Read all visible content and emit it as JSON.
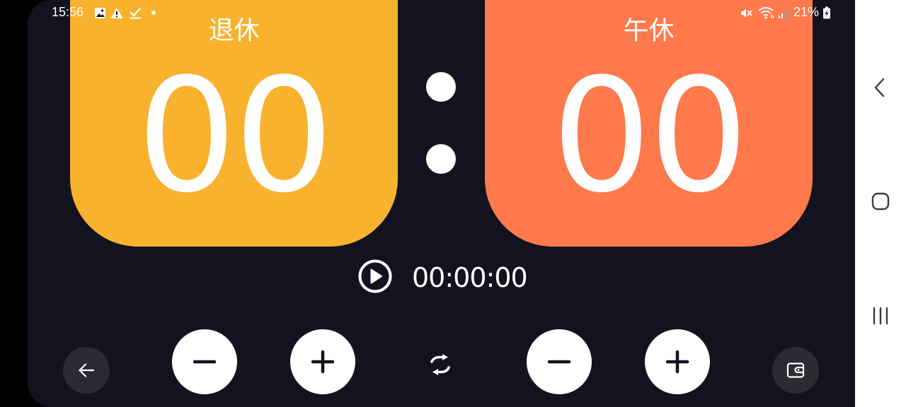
{
  "status_bar": {
    "time": "15:56",
    "battery_percent": "21%",
    "icons": [
      "image-icon",
      "warning-icon",
      "check-download-icon",
      "dot-icon",
      "mute-icon",
      "wifi-icon",
      "signal-icon",
      "battery-charging-icon"
    ]
  },
  "scoreboard": {
    "left": {
      "name": "退休",
      "score": "00",
      "color": "#f8b22d"
    },
    "right": {
      "name": "午休",
      "score": "00",
      "color": "#fe794c"
    }
  },
  "timer": {
    "display": "00:00:00",
    "play_icon": "play-circle-icon"
  },
  "controls": {
    "back_icon": "arrow-left-icon",
    "minus_icon": "minus-icon",
    "plus_icon": "plus-icon",
    "swap_icon": "swap-icon",
    "wallet_icon": "wallet-icon"
  },
  "nav_bar": {
    "back_icon": "chevron-left-icon",
    "home_icon": "rounded-square-icon",
    "recents_icon": "three-bars-icon"
  },
  "colors": {
    "background": "#13131f",
    "card_left": "#f8b22d",
    "card_right": "#fe794c",
    "button_dark": "#2b2b33"
  }
}
